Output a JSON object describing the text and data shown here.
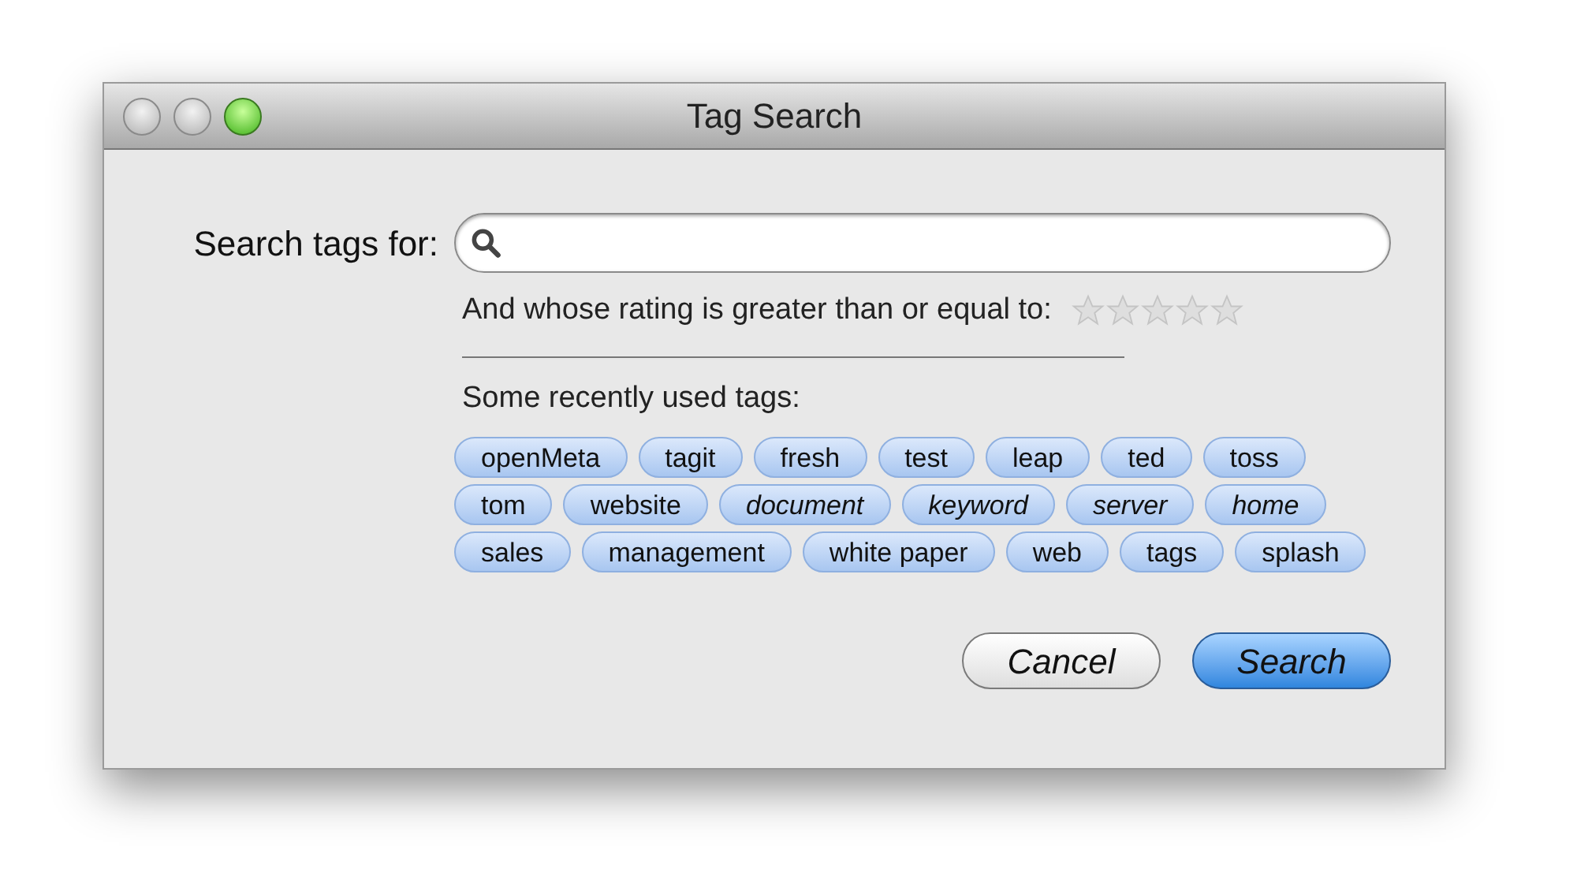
{
  "window": {
    "title": "Tag Search",
    "traffic_lights": [
      {
        "selected": false
      },
      {
        "selected": false
      },
      {
        "selected": true
      }
    ]
  },
  "search": {
    "label": "Search tags for:"
  },
  "rating": {
    "label": "And whose rating is greater than or equal to:",
    "stars": 0
  },
  "recent": {
    "label": "Some recently used tags:",
    "tags": [
      {
        "label": "openMeta",
        "italic": false
      },
      {
        "label": "tagit",
        "italic": false
      },
      {
        "label": "fresh",
        "italic": false
      },
      {
        "label": "test",
        "italic": false
      },
      {
        "label": "leap",
        "italic": false
      },
      {
        "label": "ted",
        "italic": false
      },
      {
        "label": "toss",
        "italic": false
      },
      {
        "label": "tom",
        "italic": false
      },
      {
        "label": "website",
        "italic": false
      },
      {
        "label": "document",
        "italic": true
      },
      {
        "label": "keyword",
        "italic": true
      },
      {
        "label": "server",
        "italic": true
      },
      {
        "label": "home",
        "italic": true
      },
      {
        "label": "sales",
        "italic": false
      },
      {
        "label": "management",
        "italic": false
      },
      {
        "label": "white paper",
        "italic": false
      },
      {
        "label": "web",
        "italic": false
      },
      {
        "label": "tags",
        "italic": false
      },
      {
        "label": "splash",
        "italic": false
      }
    ]
  },
  "buttons": [
    {
      "label": "Cancel",
      "kind": "secondary"
    },
    {
      "label": "Search",
      "kind": "default"
    }
  ]
}
